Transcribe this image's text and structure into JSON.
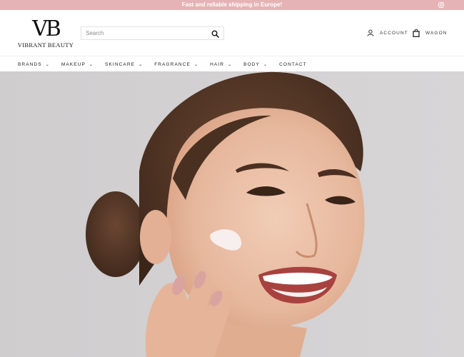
{
  "announcement": {
    "text": "Fast and reliable shipping in Europe!",
    "icon": "instagram-icon",
    "color": "#e5b3b5"
  },
  "logo": {
    "mark": "VB",
    "text": "VIBRANT BEAUTY"
  },
  "search": {
    "placeholder": "Search",
    "icon": "search-icon"
  },
  "utility": {
    "account_label": "ACCOUNT",
    "wagon_label": "WAGON"
  },
  "nav": {
    "items": [
      {
        "label": "BRANDS",
        "dropdown": true
      },
      {
        "label": "MAKEUP",
        "dropdown": true
      },
      {
        "label": "SKINCARE",
        "dropdown": true
      },
      {
        "label": "FRAGRANCE",
        "dropdown": true
      },
      {
        "label": "HAIR",
        "dropdown": true
      },
      {
        "label": "BODY",
        "dropdown": true
      },
      {
        "label": "CONTACT",
        "dropdown": false
      }
    ]
  },
  "hero": {
    "background": "#d3d1d2"
  }
}
